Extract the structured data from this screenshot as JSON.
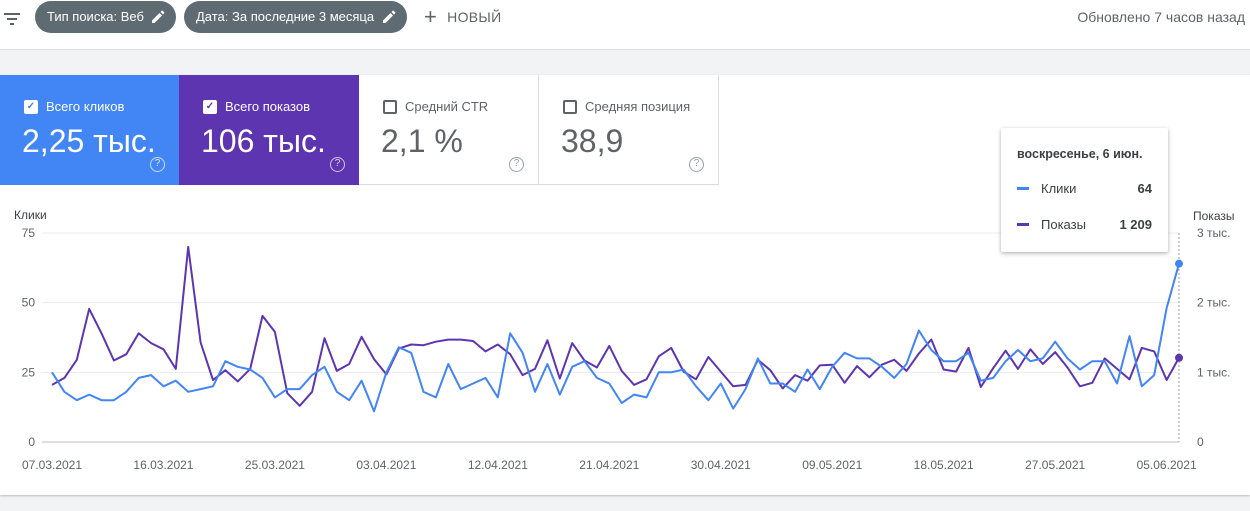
{
  "filters": {
    "search_type": "Тип поиска: Веб",
    "date": "Дата: За последние 3 месяца",
    "new_label": "НОВЫЙ",
    "updated": "Обновлено 7 часов назад"
  },
  "metrics": {
    "clicks": {
      "label": "Всего кликов",
      "value": "2,25 тыс.",
      "checked": true
    },
    "impressions": {
      "label": "Всего показов",
      "value": "106 тыс.",
      "checked": true
    },
    "ctr": {
      "label": "Средний CTR",
      "value": "2,1 %",
      "checked": false
    },
    "position": {
      "label": "Средняя позиция",
      "value": "38,9",
      "checked": false
    }
  },
  "tooltip": {
    "date": "воскресенье, 6 июн.",
    "rows": [
      {
        "name": "Клики",
        "value": "64"
      },
      {
        "name": "Показы",
        "value": "1 209"
      }
    ]
  },
  "colors": {
    "clicks": "#4285f4",
    "impressions": "#5e35b1"
  },
  "chart_data": {
    "type": "line",
    "x_start": "07.03.2021",
    "x_end": "06.06.2021",
    "x_tick_labels": [
      "07.03.2021",
      "16.03.2021",
      "25.03.2021",
      "03.04.2021",
      "12.04.2021",
      "21.04.2021",
      "30.04.2021",
      "09.05.2021",
      "18.05.2021",
      "27.05.2021",
      "05.06.2021"
    ],
    "y_left": {
      "label": "Клики",
      "ylim": [
        0,
        75
      ],
      "ticks": [
        "0",
        "25",
        "50",
        "75"
      ]
    },
    "y_right": {
      "label": "Показы",
      "ylim": [
        0,
        3000
      ],
      "ticks": [
        "0",
        "1 тыс.",
        "2 тыс.",
        "3 тыс."
      ]
    },
    "grid": true,
    "series": [
      {
        "name": "Клики",
        "axis": "left",
        "values": [
          25,
          18,
          15,
          17,
          15,
          15,
          18,
          23,
          24,
          20,
          22,
          18,
          19,
          20,
          29,
          27,
          26,
          23,
          16,
          19,
          19,
          24,
          27,
          18,
          15,
          22,
          11,
          25,
          34,
          32,
          18,
          16,
          28,
          19,
          21,
          23,
          16,
          39,
          32,
          18,
          28,
          17,
          27,
          29,
          23,
          21,
          14,
          17,
          16,
          25,
          25,
          26,
          20,
          15,
          21,
          12,
          19,
          30,
          21,
          21,
          18,
          26,
          19,
          27,
          32,
          30,
          30,
          27,
          23,
          28,
          40,
          33,
          29,
          29,
          32,
          22,
          23,
          29,
          33,
          29,
          30,
          36,
          30,
          26,
          29,
          29,
          21,
          38,
          20,
          24,
          48,
          64
        ]
      },
      {
        "name": "Показы",
        "axis": "right",
        "values": [
          820,
          920,
          1180,
          1910,
          1560,
          1170,
          1260,
          1560,
          1420,
          1330,
          1050,
          2800,
          1430,
          890,
          1030,
          870,
          1050,
          1810,
          1580,
          700,
          520,
          720,
          1490,
          1020,
          1120,
          1510,
          1190,
          970,
          1340,
          1400,
          1390,
          1440,
          1470,
          1470,
          1450,
          1300,
          1400,
          1260,
          960,
          1050,
          1460,
          910,
          1420,
          1170,
          1070,
          1380,
          1020,
          820,
          900,
          1230,
          1350,
          1010,
          900,
          1220,
          1010,
          800,
          820,
          1180,
          1030,
          770,
          960,
          880,
          1100,
          1110,
          850,
          1090,
          930,
          1110,
          1180,
          1020,
          1270,
          1470,
          1040,
          1010,
          1350,
          790,
          1060,
          1310,
          1050,
          1330,
          1120,
          1290,
          1070,
          800,
          850,
          1200,
          1050,
          900,
          1350,
          1300,
          890,
          1209
        ]
      }
    ]
  }
}
